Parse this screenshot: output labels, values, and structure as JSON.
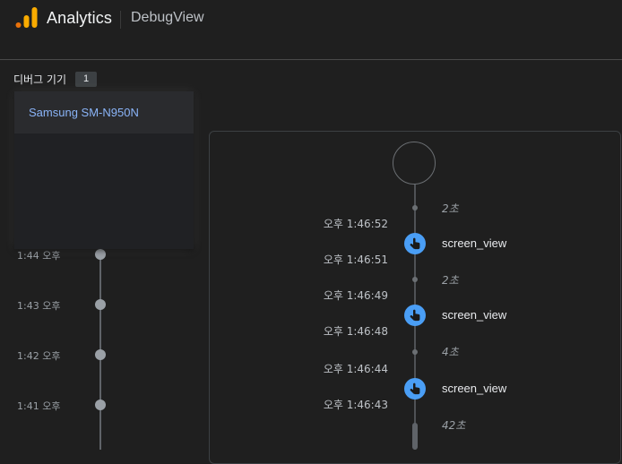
{
  "header": {
    "brand": "Analytics",
    "product": "DebugView",
    "logo_icon": "analytics-logo-icon",
    "logo_color": "#f9ab00"
  },
  "devices": {
    "label": "디버그 기기",
    "count": "1",
    "items": [
      "Samsung SM-N950N"
    ]
  },
  "minutes": [
    {
      "label": "1:44 오후"
    },
    {
      "label": "1:43 오후"
    },
    {
      "label": "1:42 오후"
    },
    {
      "label": "1:41 오후"
    }
  ],
  "seconds": {
    "gaps": [
      "2초",
      "2초",
      "4초",
      "42초"
    ],
    "events": [
      {
        "name": "screen_view",
        "time_top": "오후 1:46:52",
        "time_bottom": "오후 1:46:51",
        "icon": "touch-hand-icon"
      },
      {
        "name": "screen_view",
        "time_top": "오후 1:46:49",
        "time_bottom": "오후 1:46:48",
        "icon": "touch-hand-icon"
      },
      {
        "name": "screen_view",
        "time_top": "오후 1:46:44",
        "time_bottom": "오후 1:46:43",
        "icon": "touch-hand-icon"
      }
    ],
    "event_color": "#4a9ef5"
  }
}
